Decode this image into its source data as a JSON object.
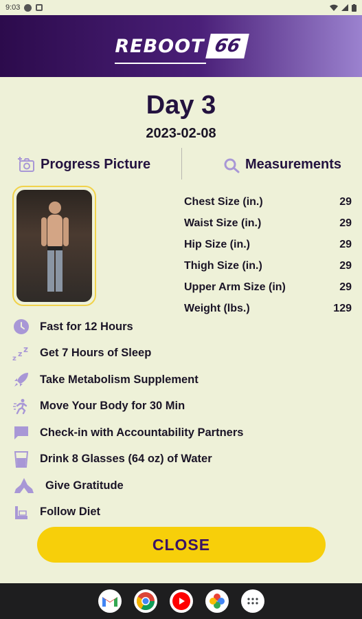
{
  "status_bar": {
    "time": "9:03"
  },
  "header": {
    "brand": "REBOOT",
    "number": "66"
  },
  "day": {
    "title": "Day 3",
    "date": "2023-02-08"
  },
  "sections": {
    "progress_picture": "Progress Picture",
    "measurements": "Measurements"
  },
  "measurements": [
    {
      "label": "Chest Size (in.)",
      "value": "29"
    },
    {
      "label": "Waist Size (in.)",
      "value": "29"
    },
    {
      "label": "Hip Size (in.)",
      "value": "29"
    },
    {
      "label": "Thigh Size (in.)",
      "value": "29"
    },
    {
      "label": "Upper Arm Size (in)",
      "value": "29"
    },
    {
      "label": "Weight (lbs.)",
      "value": "129"
    }
  ],
  "habits": [
    {
      "label": "Fast for 12 Hours",
      "icon": "clock-icon"
    },
    {
      "label": "Get 7 Hours of Sleep",
      "icon": "sleep-zzz-icon"
    },
    {
      "label": "Take Metabolism Supplement",
      "icon": "rocket-icon"
    },
    {
      "label": "Move Your Body for 30 Min",
      "icon": "running-icon"
    },
    {
      "label": "Check-in with Accountability Partners",
      "icon": "chat-bubble-icon"
    },
    {
      "label": "Drink 8 Glasses (64 oz) of Water",
      "icon": "water-glass-icon"
    },
    {
      "label": "Give Gratitude",
      "icon": "praying-hands-icon"
    },
    {
      "label": "Follow Diet",
      "icon": "diet-icon"
    }
  ],
  "close_button": "CLOSE",
  "colors": {
    "accent_purple": "#3b1566",
    "icon_purple": "#a897d6",
    "button_yellow": "#f7cf0a",
    "background": "#eef1d8"
  },
  "nav_apps": [
    "gmail-icon",
    "chrome-icon",
    "youtube-icon",
    "photos-icon",
    "app-drawer-icon"
  ]
}
